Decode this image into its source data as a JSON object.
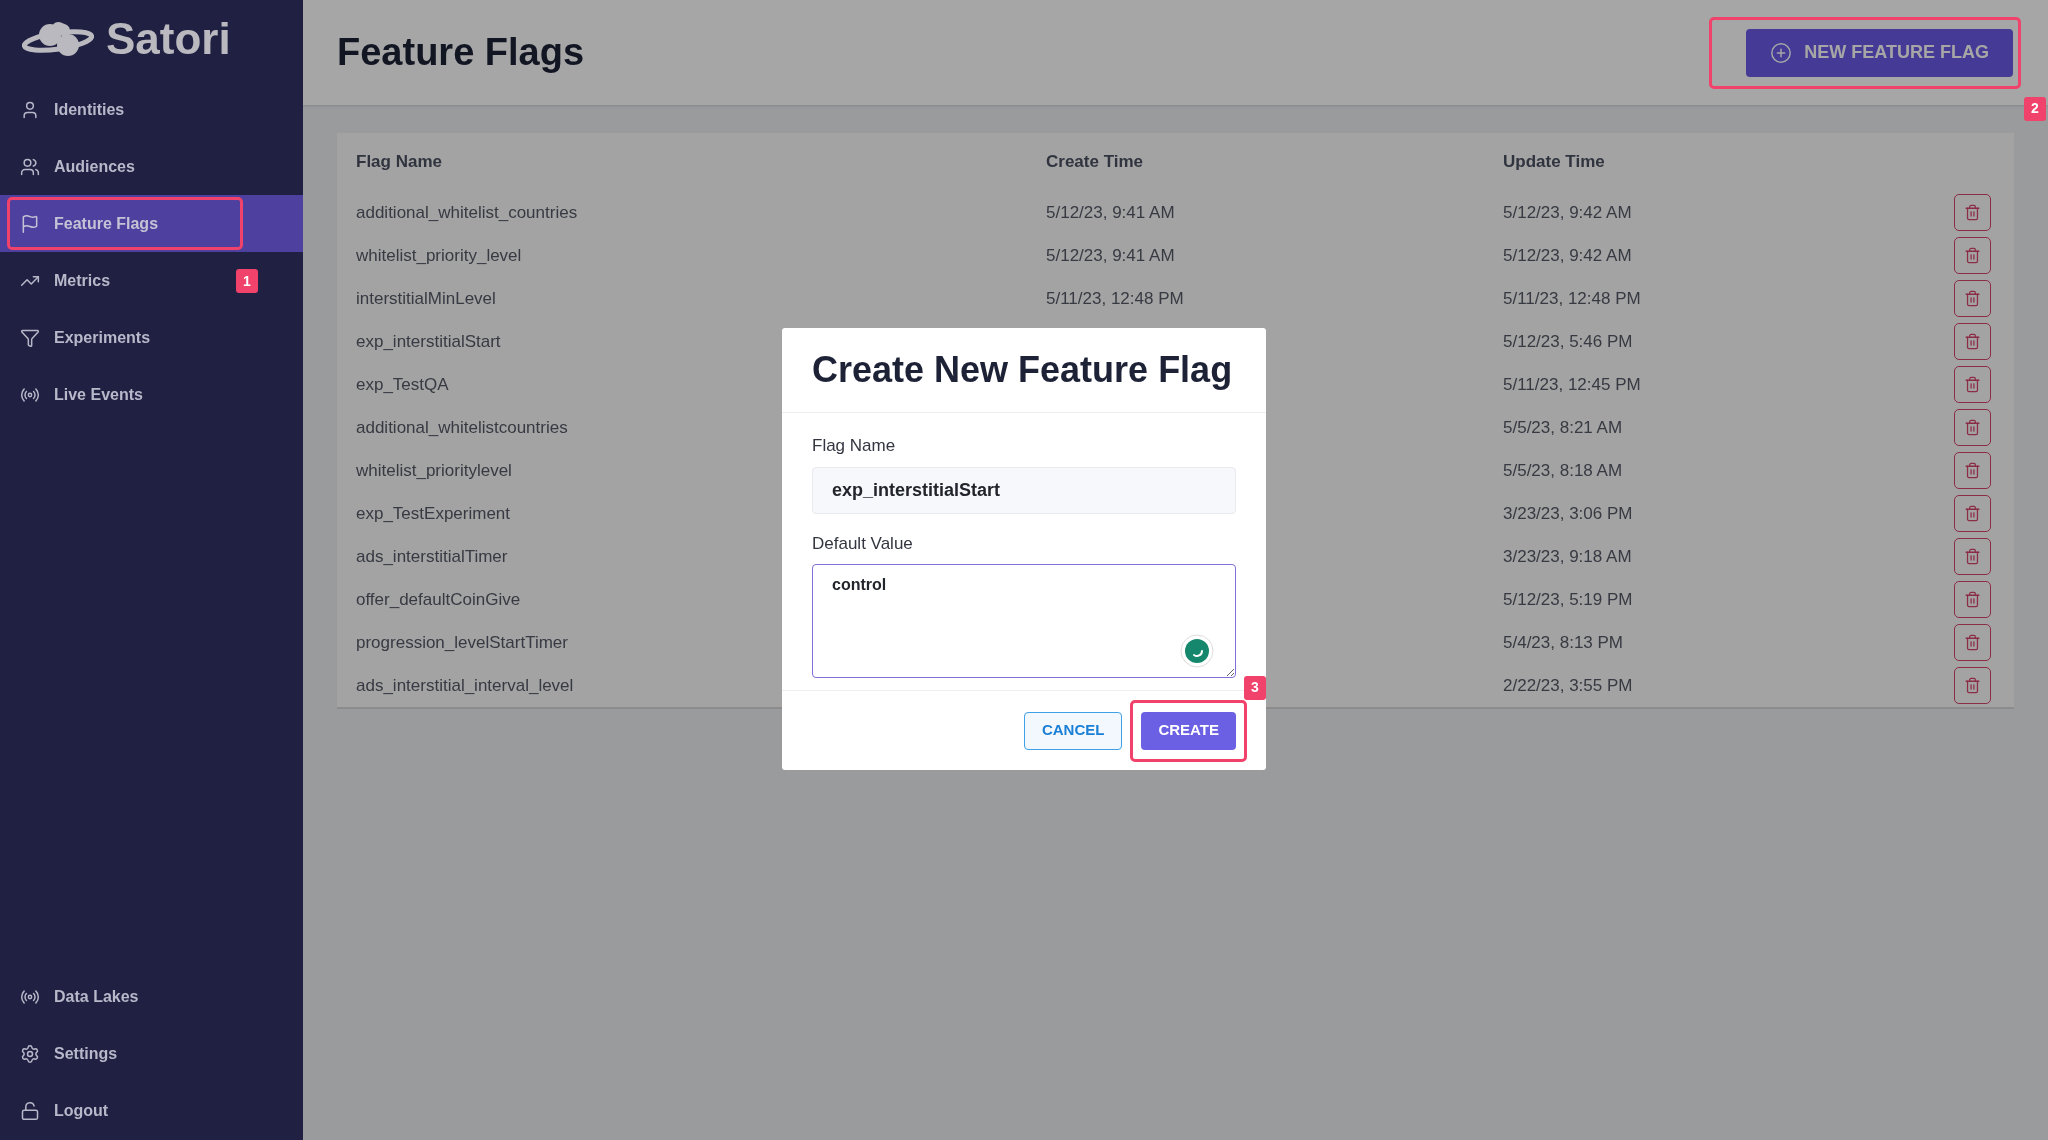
{
  "brand": {
    "name": "Satori"
  },
  "sidebar": {
    "items": [
      {
        "label": "Identities",
        "selected": false,
        "highlighted": false
      },
      {
        "label": "Audiences",
        "selected": false,
        "highlighted": false
      },
      {
        "label": "Feature Flags",
        "selected": true,
        "highlighted": true
      },
      {
        "label": "Metrics",
        "selected": false,
        "highlighted": false,
        "badge": "1"
      },
      {
        "label": "Experiments",
        "selected": false,
        "highlighted": false
      },
      {
        "label": "Live Events",
        "selected": false,
        "highlighted": false
      }
    ],
    "bottom_items": [
      {
        "label": "Data Lakes"
      },
      {
        "label": "Settings"
      },
      {
        "label": "Logout"
      }
    ]
  },
  "page": {
    "title": "Feature Flags",
    "new_button": {
      "label": "NEW FEATURE FLAG",
      "highlighted": true,
      "badge": "2"
    }
  },
  "table": {
    "columns": [
      "Flag Name",
      "Create Time",
      "Update Time"
    ],
    "rows": [
      {
        "name": "additional_whitelist_countries",
        "create_time": "5/12/23, 9:41 AM",
        "update_time": "5/12/23, 9:42 AM"
      },
      {
        "name": "whitelist_priority_level",
        "create_time": "5/12/23, 9:41 AM",
        "update_time": "5/12/23, 9:42 AM"
      },
      {
        "name": "interstitialMinLevel",
        "create_time": "5/11/23, 12:48 PM",
        "update_time": "5/11/23, 12:48 PM"
      },
      {
        "name": "exp_interstitialStart",
        "update_time": "5/12/23, 5:46 PM"
      },
      {
        "name": "exp_TestQA",
        "update_time": "5/11/23, 12:45 PM"
      },
      {
        "name": "additional_whitelistcountries",
        "update_time": "5/5/23, 8:21 AM"
      },
      {
        "name": "whitelist_prioritylevel",
        "update_time": "5/5/23, 8:18 AM"
      },
      {
        "name": "exp_TestExperiment",
        "update_time": "3/23/23, 3:06 PM"
      },
      {
        "name": "ads_interstitialTimer",
        "update_time": "3/23/23, 9:18 AM"
      },
      {
        "name": "offer_defaultCoinGive",
        "update_time": "5/12/23, 5:19 PM"
      },
      {
        "name": "progression_levelStartTimer",
        "update_time": "5/4/23, 8:13 PM"
      },
      {
        "name": "ads_interstitial_interval_level",
        "update_time": "2/22/23, 3:55 PM"
      }
    ]
  },
  "dialog": {
    "title": "Create New Feature Flag",
    "fields": [
      {
        "label": "Flag Name",
        "value": "exp_interstitialStart",
        "kind": "input"
      },
      {
        "label": "Default Value",
        "value": "control",
        "kind": "textarea"
      }
    ],
    "buttons": [
      {
        "label": "CANCEL",
        "kind": "secondary",
        "highlighted": false
      },
      {
        "label": "CREATE",
        "kind": "primary",
        "highlighted": true,
        "badge": "3"
      }
    ]
  }
}
